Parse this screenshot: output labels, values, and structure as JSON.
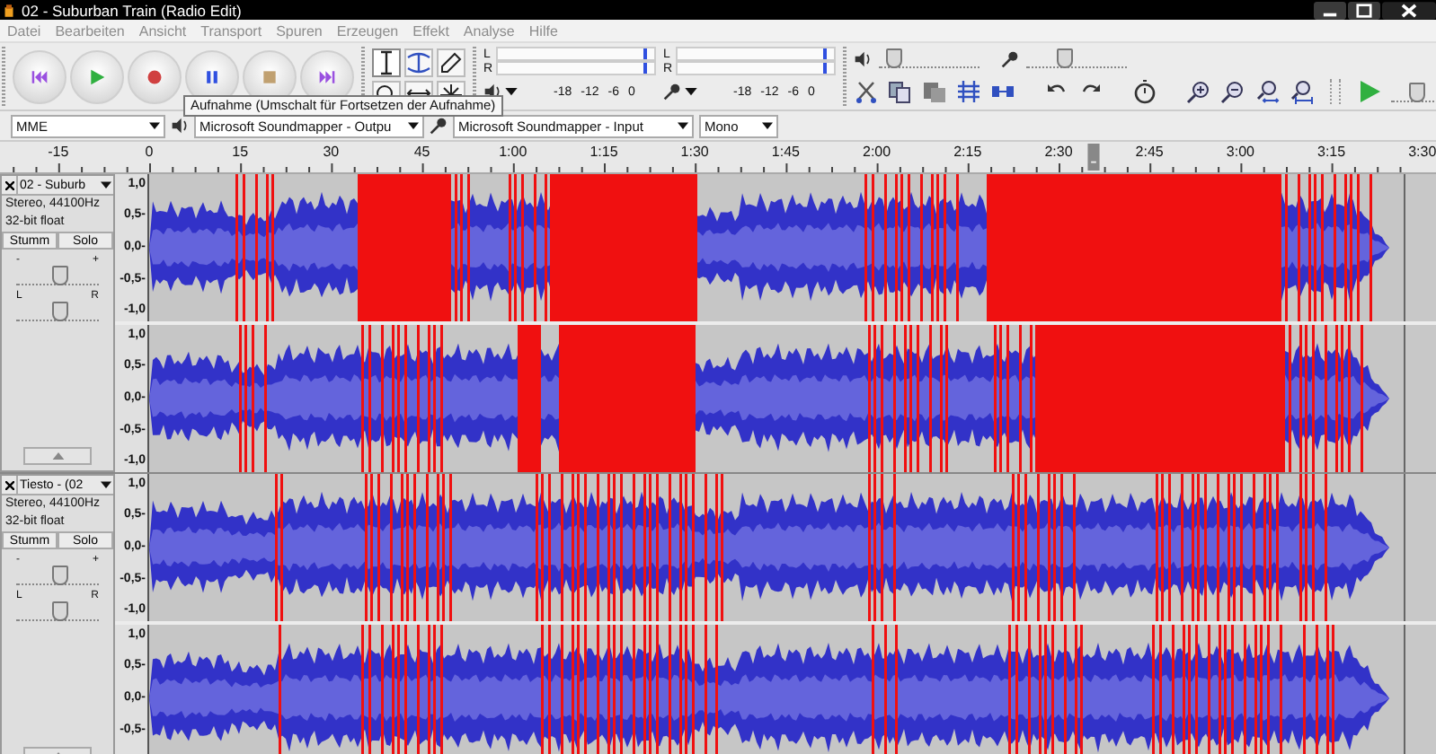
{
  "window": {
    "title": "02 - Suburban Train (Radio Edit)"
  },
  "menu": [
    {
      "label": "Datei",
      "disabled": true
    },
    {
      "label": "Bearbeiten",
      "disabled": true
    },
    {
      "label": "Ansicht",
      "disabled": true
    },
    {
      "label": "Transport",
      "disabled": true
    },
    {
      "label": "Spuren",
      "disabled": true
    },
    {
      "label": "Erzeugen",
      "disabled": true
    },
    {
      "label": "Effekt",
      "disabled": true
    },
    {
      "label": "Analyse",
      "disabled": true
    },
    {
      "label": "Hilfe",
      "disabled": true
    }
  ],
  "tooltip": "Aufnahme (Umschalt für Fortsetzen der Aufnahme)",
  "meters": [
    {
      "kind": "playback",
      "channels": [
        "L",
        "R"
      ],
      "scale": [
        "-18",
        "-12",
        "-6",
        "0"
      ]
    },
    {
      "kind": "record",
      "channels": [
        "L",
        "R"
      ],
      "scale": [
        "-18",
        "-12",
        "-6",
        "0"
      ]
    }
  ],
  "mixer": [
    {
      "kind": "playback",
      "level": 0.12
    },
    {
      "kind": "record",
      "level": 0.35
    }
  ],
  "play_at_speed": {
    "level": 0.22
  },
  "devices": {
    "host": "MME",
    "output": "Microsoft Soundmapper - Outpu",
    "input": "Microsoft Soundmapper - Input",
    "channels": "Mono"
  },
  "ruler": {
    "ticks": [
      "-15",
      "0",
      "15",
      "30",
      "45",
      "1:00",
      "1:15",
      "1:30",
      "1:45",
      "2:00",
      "2:15",
      "2:30",
      "2:45",
      "3:00",
      "3:15",
      "3:30"
    ]
  },
  "tracks": [
    {
      "name": "02 - Suburb",
      "format": "Stereo, 44100Hz",
      "sample": "32-bit float",
      "mute": "Stumm",
      "solo": "Solo",
      "gain": {
        "minus": "-",
        "plus": "+",
        "level": 0.5
      },
      "pan": {
        "left": "L",
        "right": "R",
        "level": 0.5
      },
      "channels": [
        {
          "scale": [
            "1,0",
            "0,5-",
            "0,0-",
            "-0,5-",
            "-1,0"
          ]
        },
        {
          "scale": [
            "1,0",
            "0,5-",
            "0,0-",
            "-0,5-",
            "-1,0"
          ]
        }
      ]
    },
    {
      "name": "Tiesto - (02",
      "format": "Stereo, 44100Hz",
      "sample": "32-bit float",
      "mute": "Stumm",
      "solo": "Solo",
      "gain": {
        "minus": "-",
        "plus": "+",
        "level": 0.5
      },
      "pan": {
        "left": "L",
        "right": "R",
        "level": 0.5
      },
      "channels": [
        {
          "scale": [
            "1,0",
            "0,5-",
            "0,0-",
            "-0,5-",
            "-1,0"
          ]
        },
        {
          "scale": [
            "1,0",
            "0,5-",
            "0,0-",
            "-0,5-"
          ]
        }
      ]
    }
  ]
}
